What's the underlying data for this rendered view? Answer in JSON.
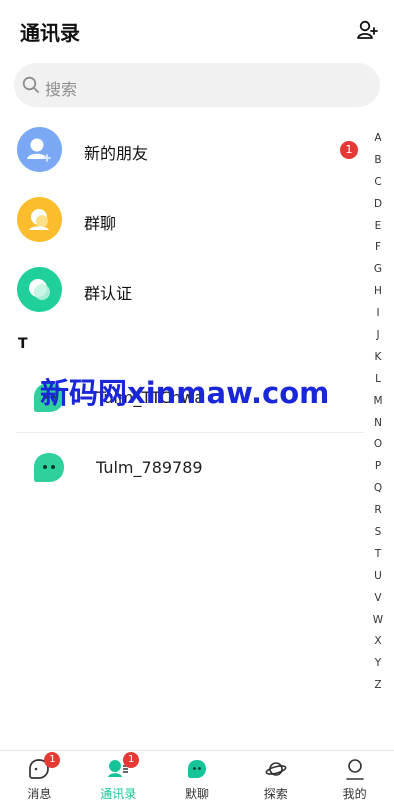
{
  "header": {
    "title": "通讯录",
    "add_icon": "add-friend-icon"
  },
  "search": {
    "placeholder": "搜索",
    "icon": "search-icon"
  },
  "features": [
    {
      "label": "新的朋友",
      "icon": "new-friend-icon",
      "color": "#7aa8f5",
      "badge": "1"
    },
    {
      "label": "群聊",
      "icon": "group-chat-icon",
      "color": "#fbbd2c"
    },
    {
      "label": "群认证",
      "icon": "group-verify-icon",
      "color": "#1fd09a"
    }
  ],
  "contacts": {
    "section": "T",
    "items": [
      {
        "name": "Tulm_TTChwa",
        "icon": "bot-avatar-icon"
      },
      {
        "name": "Tulm_789789",
        "icon": "bot-avatar-icon"
      }
    ]
  },
  "index_letters": [
    "A",
    "B",
    "C",
    "D",
    "E",
    "F",
    "G",
    "H",
    "I",
    "J",
    "K",
    "L",
    "M",
    "N",
    "O",
    "P",
    "Q",
    "R",
    "S",
    "T",
    "U",
    "V",
    "W",
    "X",
    "Y",
    "Z"
  ],
  "watermark": "新码网xinmaw.com",
  "tabbar": {
    "tabs": [
      {
        "label": "消息",
        "icon": "message-icon",
        "badge": "1"
      },
      {
        "label": "通讯录",
        "icon": "contacts-icon",
        "badge": "1",
        "active": true
      },
      {
        "label": "默聊",
        "icon": "chat-bot-icon"
      },
      {
        "label": "探索",
        "icon": "planet-icon"
      },
      {
        "label": "我的",
        "icon": "profile-icon"
      }
    ]
  },
  "colors": {
    "accent": "#16c49a",
    "badge": "#e53935",
    "watermark": "#1a27d8"
  }
}
